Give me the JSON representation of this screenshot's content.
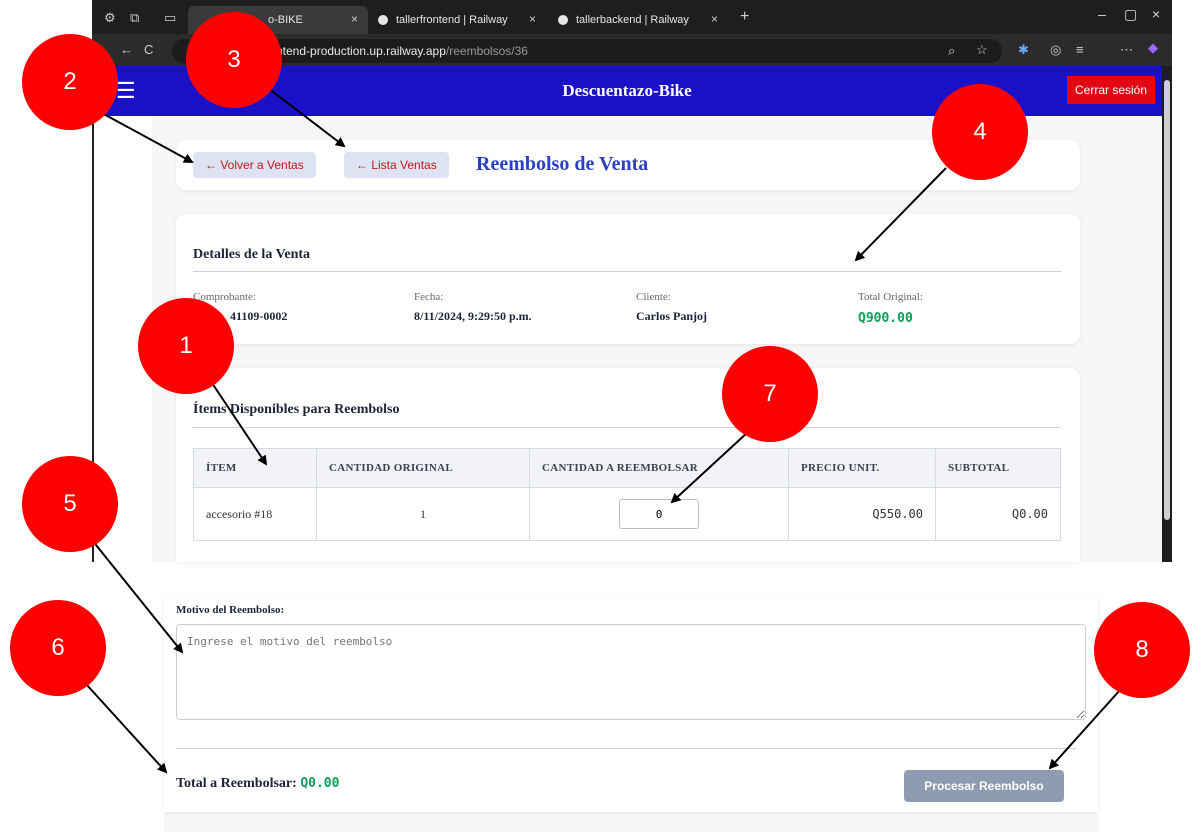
{
  "browser": {
    "tabs": [
      {
        "title": "o-BIKE",
        "close": "×"
      },
      {
        "title": "tallerfrontend | Railway",
        "close": "×"
      },
      {
        "title": "tallerbackend | Railway",
        "close": "×"
      }
    ],
    "new_tab": "+",
    "window_controls": [
      "–",
      "▢",
      "×"
    ],
    "address": {
      "domain": "ntend-production.up.railway.app",
      "path": "/reembolsos/36"
    }
  },
  "app": {
    "brand": "Descuentazo-Bike",
    "logout": "Cerrar sesión",
    "menu_icon": "☰"
  },
  "header": {
    "back_ventas": "← Volver a Ventas",
    "lista_ventas": "← Lista Ventas",
    "title": "Reembolso de Venta"
  },
  "details": {
    "title": "Detalles de la Venta",
    "comprobante": {
      "label": "Comprobante:",
      "value": "41109-0002"
    },
    "fecha": {
      "label": "Fecha:",
      "value": "8/11/2024, 9:29:50 p.m."
    },
    "cliente": {
      "label": "Cliente:",
      "value": "Carlos Panjoj"
    },
    "total": {
      "label": "Total Original:",
      "value": "Q900.00"
    }
  },
  "items": {
    "title": "Ítems Disponibles para Reembolso",
    "columns": [
      "ÍTEM",
      "CANTIDAD ORIGINAL",
      "CANTIDAD A REEMBOLSAR",
      "PRECIO UNIT.",
      "SUBTOTAL"
    ],
    "rows": [
      {
        "item": "accesorio #18",
        "cantidad": "1",
        "reembolsar": "0",
        "precio": "Q550.00",
        "subtotal": "Q0.00"
      }
    ]
  },
  "motivo": {
    "label": "Motivo del Reembolso:",
    "placeholder": "Ingrese el motivo del reembolso"
  },
  "footer": {
    "total_label": "Total a Reembolsar:",
    "total_value": "Q0.00",
    "process": "Procesar Reembolso"
  },
  "annotations": [
    "2",
    "3",
    "4",
    "1",
    "7",
    "5",
    "6",
    "8"
  ],
  "colors": {
    "navbar": "#1a10c8",
    "logout": "#e30613",
    "marker": "#ff0000",
    "money": "#0f9d58"
  }
}
